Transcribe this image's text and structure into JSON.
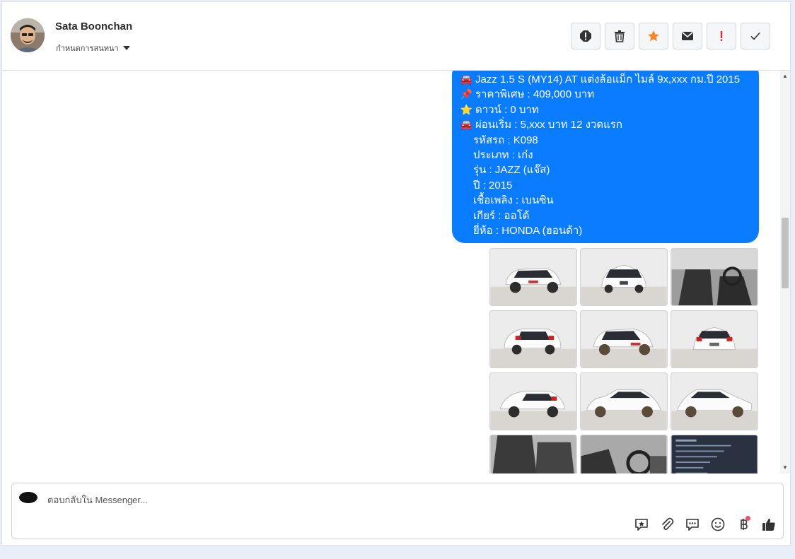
{
  "header": {
    "name": "Sata Boonchan",
    "assign_label": "กำหนดการสนทนา",
    "actions": [
      {
        "name": "report-icon"
      },
      {
        "name": "trash-icon"
      },
      {
        "name": "star-icon"
      },
      {
        "name": "mail-icon"
      },
      {
        "name": "priority-icon"
      },
      {
        "name": "check-icon"
      }
    ]
  },
  "message": {
    "lines": [
      {
        "icon": "🚘",
        "text": "Jazz 1.5 S (MY14) AT แต่งล้อแม็ก ไมล์ 9x,xxx กม.ปี 2015"
      },
      {
        "icon": "📌",
        "text": "ราคาพิเศษ : 409,000 บาท"
      },
      {
        "icon": "⭐",
        "text": "ดาวน์ : 0 บาท"
      },
      {
        "icon": "🚘",
        "text": "ผ่อนเริ่ม : 5,xxx บาท 12 งวดแรก"
      },
      {
        "icon": "",
        "text": "รหัสรถ : K098"
      },
      {
        "icon": "",
        "text": "ประเภท : เก๋ง"
      },
      {
        "icon": "",
        "text": "รุ่น : JAZZ (แจ๊ส)"
      },
      {
        "icon": "",
        "text": "ปี : 2015"
      },
      {
        "icon": "",
        "text": "เชื้อเพลิง : เบนซิน"
      },
      {
        "icon": "",
        "text": "เกียร์ : ออโต้"
      },
      {
        "icon": "",
        "text": "ยี่ห้อ : HONDA (ฮอนด้า)"
      }
    ]
  },
  "composer": {
    "placeholder": "ตอบกลับใน Messenger..."
  },
  "colors": {
    "bubble": "#0a7cff",
    "star": "#f5882b",
    "priority": "#e02d2d"
  }
}
